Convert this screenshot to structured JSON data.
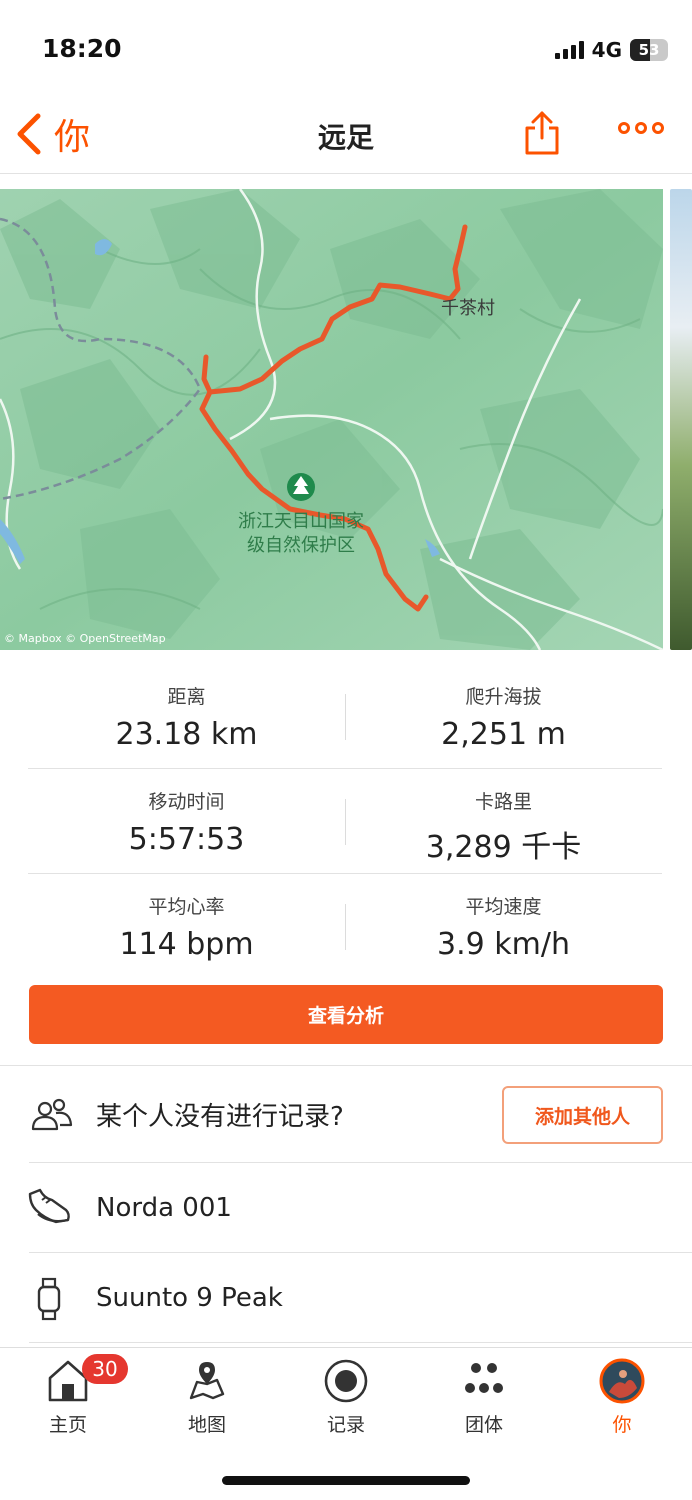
{
  "status_bar": {
    "time": "18:20",
    "network": "4G",
    "battery": "53"
  },
  "nav": {
    "back_label": "你",
    "title": "远足"
  },
  "map": {
    "place_label": "千茶村",
    "poi_label_line1": "浙江天目山国家",
    "poi_label_line2": "级自然保护区",
    "attribution": "© Mapbox © OpenStreetMap",
    "route_color": "#e8582b"
  },
  "stats": [
    {
      "left": {
        "label": "距离",
        "value": "23.18 km"
      },
      "right": {
        "label": "爬升海拔",
        "value": "2,251 m"
      }
    },
    {
      "left": {
        "label": "移动时间",
        "value": "5:57:53"
      },
      "right": {
        "label": "卡路里",
        "value": "3,289 千卡"
      }
    },
    {
      "left": {
        "label": "平均心率",
        "value": "114 bpm"
      },
      "right": {
        "label": "平均速度",
        "value": "3.9 km/h"
      }
    }
  ],
  "analyze_button": "查看分析",
  "people": {
    "text": "某个人没有进行记录?",
    "add_button": "添加其他人"
  },
  "gear": {
    "shoes": "Norda 001",
    "device": "Suunto 9 Peak"
  },
  "tabbar": {
    "home": "主页",
    "home_badge": "30",
    "maps": "地图",
    "record": "记录",
    "groups": "团体",
    "you": "你"
  },
  "colors": {
    "accent": "#fc5200",
    "button": "#f45a22",
    "badge": "#e5372f"
  }
}
